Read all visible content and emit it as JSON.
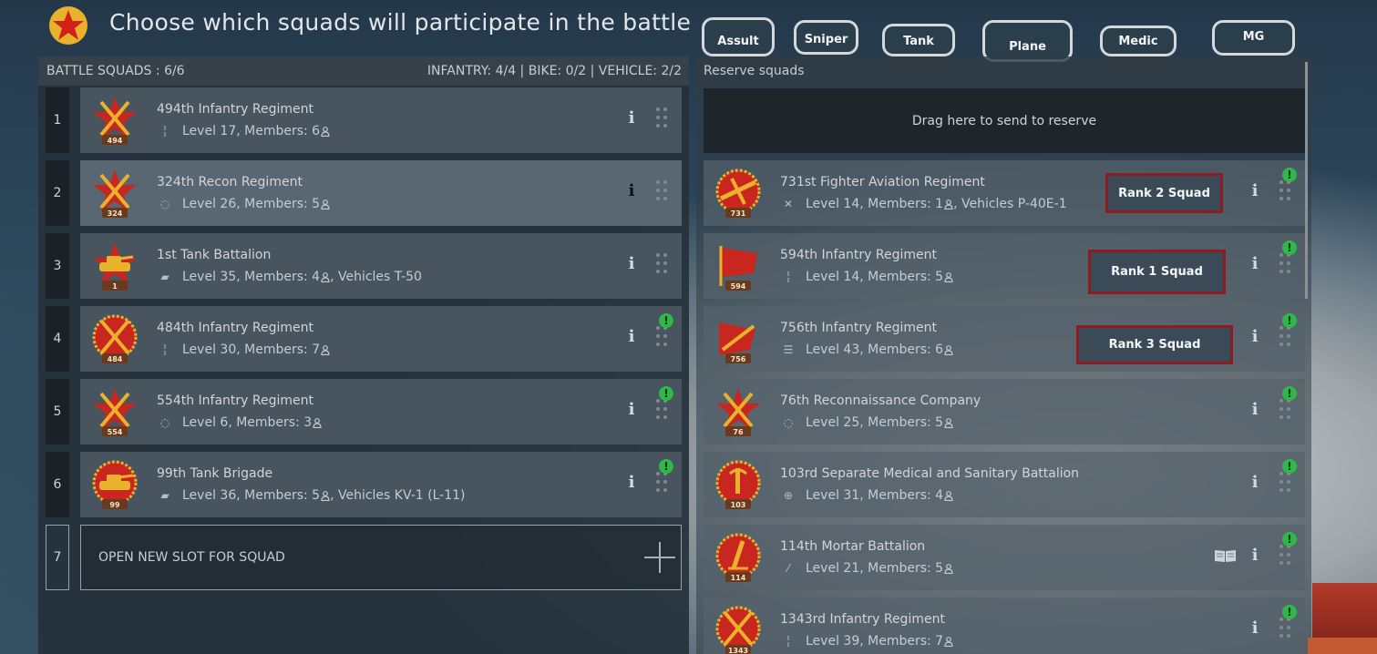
{
  "title": "Choose which squads will participate in the battle",
  "filters": [
    "Assult",
    "Sniper",
    "Tank",
    "Plane",
    "Medic",
    "MG"
  ],
  "left_header": {
    "battle_squads": "BATTLE SQUADS : 6/6",
    "counts": "INFANTRY: 4/4 | BIKE: 0/2 | VEHICLE: 2/2"
  },
  "battle_squads": [
    {
      "slot": "1",
      "name": "494th Infantry Regiment",
      "info": "Level 17, Members: 6",
      "badge": "494",
      "type": "infantry"
    },
    {
      "slot": "2",
      "name": "324th Recon Regiment",
      "info": "Level 26, Members: 5",
      "badge": "324",
      "type": "recon"
    },
    {
      "slot": "3",
      "name": "1st Tank Battalion",
      "info": "Level 35, Members: 4",
      "vehicles": ", Vehicles T-50",
      "badge": "1",
      "type": "tank"
    },
    {
      "slot": "4",
      "name": "484th Infantry Regiment",
      "info": "Level 30, Members: 7",
      "badge": "484",
      "type": "infantry"
    },
    {
      "slot": "5",
      "name": "554th Infantry Regiment",
      "info": "Level 6, Members: 3",
      "badge": "554",
      "type": "recon"
    },
    {
      "slot": "6",
      "name": "99th Tank Brigade",
      "info": "Level 36, Members: 5",
      "vehicles": ", Vehicles KV-1 (L-11)",
      "badge": "99",
      "type": "tank"
    }
  ],
  "open_slot": {
    "num": "7",
    "label": "OPEN NEW SLOT FOR SQUAD"
  },
  "right_header": "Reserve squads",
  "drop_zone": "Drag here to send to reserve",
  "reserve_squads": [
    {
      "name": "731st Fighter Aviation Regiment",
      "info": "Level 14, Members: 1",
      "vehicles": ", Vehicles P-40E-1",
      "badge": "731",
      "type": "plane"
    },
    {
      "name": "594th Infantry Regiment",
      "info": "Level 14, Members: 5",
      "badge": "594",
      "type": "infantry"
    },
    {
      "name": "756th Infantry Regiment",
      "info": "Level 43, Members: 6",
      "badge": "756",
      "type": "assault"
    },
    {
      "name": "76th Reconnaissance Company",
      "info": "Level 25, Members: 5",
      "badge": "76",
      "type": "recon"
    },
    {
      "name": "103rd Separate Medical and Sanitary Battalion",
      "info": "Level 31, Members: 4",
      "badge": "103",
      "type": "medic"
    },
    {
      "name": "114th Mortar Battalion",
      "info": "Level 21, Members: 5",
      "badge": "114",
      "type": "mortar"
    },
    {
      "name": "1343rd Infantry Regiment",
      "info": "Level 39, Members: 7",
      "badge": "1343",
      "type": "infantry"
    }
  ],
  "rank_labels": [
    "Rank 2 Squad",
    "Rank 1 Squad",
    "Rank 3 Squad"
  ],
  "colors": {
    "accent_red": "#c8261e",
    "alert_green": "#2fb84a",
    "rank_border": "#8d1b22",
    "emblem_gold": "#e9b22d"
  }
}
